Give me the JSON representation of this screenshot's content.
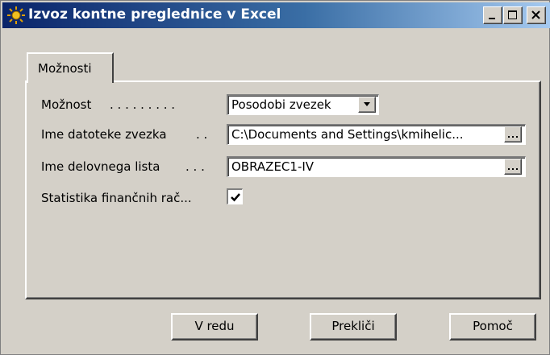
{
  "window": {
    "title": "Izvoz kontne preglednice v Excel",
    "controls": {
      "minimize_icon": "minimize-icon",
      "maximize_icon": "maximize-icon",
      "close_icon": "close-icon"
    }
  },
  "tabs": [
    {
      "label": "Možnosti",
      "active": true
    }
  ],
  "form": {
    "option": {
      "label": "Možnost",
      "dots": ". . . . . . . . .",
      "value": "Posodobi zvezek"
    },
    "workbook_file": {
      "label": "Ime datoteke zvezka",
      "dots": ". .",
      "value": "C:\\Documents and Settings\\kmihelic..."
    },
    "worksheet_name": {
      "label": "Ime delovnega lista",
      "dots": ". . .",
      "value": "OBRAZEC1-IV"
    },
    "statistics": {
      "label": "Statistika finančnih rač...",
      "checked": true
    }
  },
  "buttons": {
    "ok": "V redu",
    "cancel": "Prekliči",
    "help": "Pomoč"
  },
  "colors": {
    "titlebar_start": "#0a246a",
    "titlebar_end": "#a6caf0",
    "face": "#d4d0c8"
  }
}
